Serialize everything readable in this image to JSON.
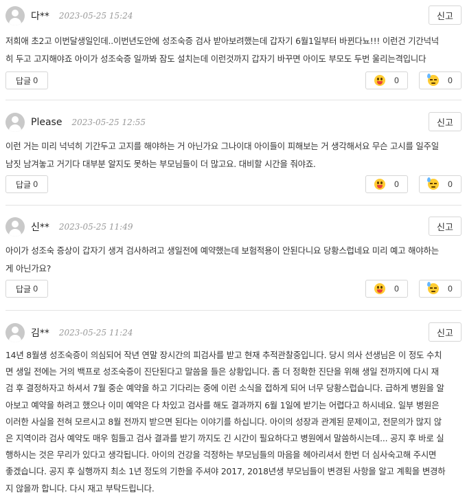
{
  "actions": {
    "report_label": "신고",
    "reply_prefix": "답글"
  },
  "comments": [
    {
      "author": "다**",
      "date": "2023-05-25 15:24",
      "lines": [
        "저희애 초2고 이번달생일인데..이번년도안에 성조숙증 검사 받아보려했는데 갑자기 6월1일부터 바뀐다뇨!!! 이런건 기간넉넉",
        "히 두고 고지해야죠 아이가 성조숙증 일까봐 잠도 설치는데 이런것까지 갑자기 바꾸면 아이도 부모도 두번 울리는격입니다"
      ],
      "reply_count": "0",
      "likes": "0",
      "sads": "0"
    },
    {
      "author": "Please",
      "date": "2023-05-25 12:55",
      "lines": [
        "이런 거는 미리 넉넉히 기간두고 고지를 해야하는 거 아닌가요 그나이대 아이들이 피해보는 거 생각해서요 무슨 고시를 일주일",
        "남짓 남겨놓고 거기다 대부분 알지도 못하는 부모님들이 더 많고요. 대비할 시간을 줘야죠."
      ],
      "reply_count": "0",
      "likes": "0",
      "sads": "0"
    },
    {
      "author": "신**",
      "date": "2023-05-25 11:49",
      "lines": [
        "아이가 성조숙 증상이 갑자기 생겨 검사하려고 생일전에 예약했는데 보험적용이 안된다니요 당황스럽네요 미리 예고 해야하는",
        "게 아닌가요?"
      ],
      "reply_count": "0",
      "likes": "0",
      "sads": "0"
    },
    {
      "author": "김**",
      "date": "2023-05-25 11:24",
      "lines": [
        "14년 8월생 성조숙증이 의심되어 작년 연말 장시간의 피검사를 받고 현재 추적관찰중입니다. 당시 의사 선생님은 이 정도 수치",
        "면 생일 전에는 거의 백프로 성조숙증이 진단된다고 말씀을 들은 상황입니다. 좀 더 정확한 진단을 위해 생일 전까지에 다시 재",
        "검 후 결정하자고 하셔서 7월 중순 예약을 하고 기다리는 중에 이런 소식을 접하게 되어 너무 당황스럽습니다. 급하게 병원을 알",
        "아보고 예약을 하려고 했으나 이미 예약은 다 차있고 검사를 해도 결과까지 6월 1일에 받기는 어렵다고 하시네요. 일부 병원은",
        "이러한 사실을 전혀 모르시고 8월 전까지 받으면 된다는 이야기를 하십니다. 아이의 성장과 관계된 문제이고, 전문의가 많지 않",
        "은 지역이라 검사 예약도 매우 힘들고 검사 결과를 받기 까지도 긴 시간이 필요하다고 병원에서 말씀하시는데... 공지 후 바로 실",
        "행하시는 것은 무리가 있다고 생각됩니다. 아이의 건강을 걱정하는 부모님들의 마음을 헤아리셔서 한번 더 심사숙고해 주시면",
        "좋겠습니다. 공지 후 실행까지 최소 1년 정도의 기한을 주셔야 2017, 2018년생 부모님들이 변경된 사항을 알고 계획을 변경하",
        "지 않을까 합니다. 다시 재고 부탁드립니다."
      ]
    }
  ],
  "icons": {
    "like": "grinning-face-icon",
    "sad": "sweating-face-icon",
    "avatar": "user-avatar-icon"
  }
}
